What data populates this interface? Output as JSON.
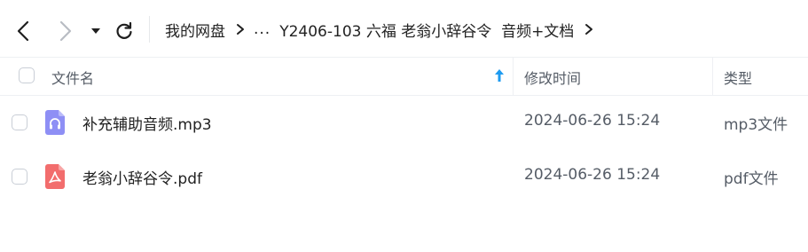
{
  "navigation": {
    "back_icon": "chevron-left-icon",
    "forward_icon": "chevron-right-icon",
    "history_icon": "caret-down-icon",
    "refresh_icon": "refresh-icon"
  },
  "breadcrumb": {
    "root": "我的网盘",
    "ellipsis": "...",
    "current": "Y2406-103 六福 老翁小辞谷令  音频+文档"
  },
  "header": {
    "name_label": "文件名",
    "time_label": "修改时间",
    "type_label": "类型",
    "sort_icon": "arrow-up-icon"
  },
  "colors": {
    "sort_accent": "#1e9bf0",
    "audio_icon": "#8e8ff5",
    "pdf_icon": "#f26d6d"
  },
  "files": [
    {
      "name": "补充辅助音频.mp3",
      "modified": "2024-06-26 15:24",
      "type": "mp3文件",
      "icon": "audio-file-icon"
    },
    {
      "name": "老翁小辞谷令.pdf",
      "modified": "2024-06-26 15:24",
      "type": "pdf文件",
      "icon": "pdf-file-icon"
    }
  ]
}
